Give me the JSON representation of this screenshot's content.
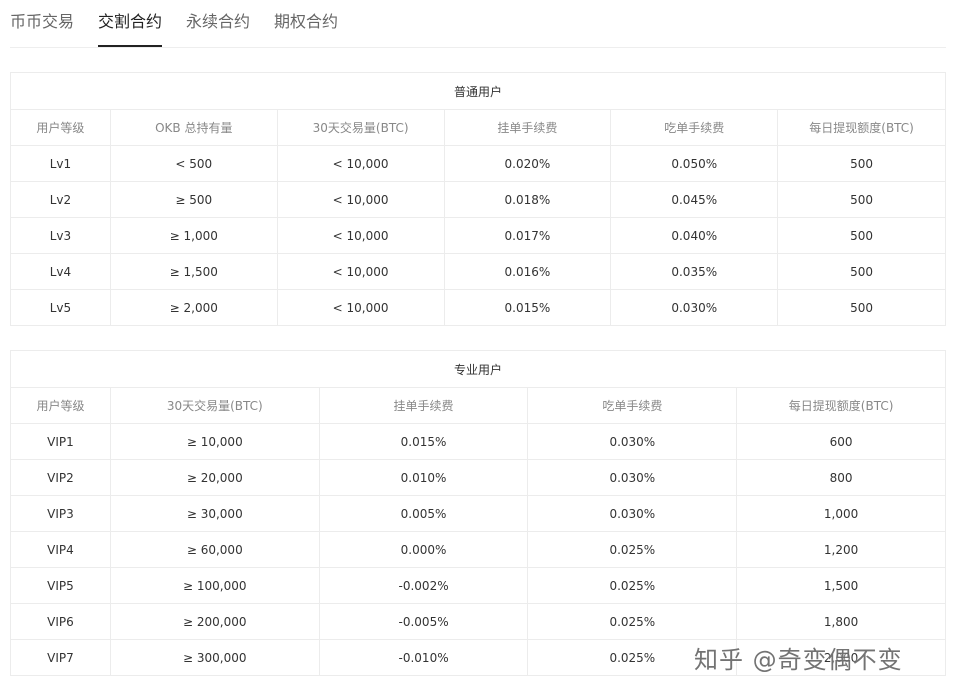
{
  "tabs": [
    {
      "label": "币币交易",
      "active": false
    },
    {
      "label": "交割合约",
      "active": true
    },
    {
      "label": "永续合约",
      "active": false
    },
    {
      "label": "期权合约",
      "active": false
    }
  ],
  "regular": {
    "title": "普通用户",
    "headers": [
      "用户等级",
      "OKB 总持有量",
      "30天交易量(BTC)",
      "挂单手续费",
      "吃单手续费",
      "每日提现额度(BTC)"
    ],
    "rows": [
      [
        "Lv1",
        "< 500",
        "< 10,000",
        "0.020%",
        "0.050%",
        "500"
      ],
      [
        "Lv2",
        "≥ 500",
        "< 10,000",
        "0.018%",
        "0.045%",
        "500"
      ],
      [
        "Lv3",
        "≥ 1,000",
        "< 10,000",
        "0.017%",
        "0.040%",
        "500"
      ],
      [
        "Lv4",
        "≥ 1,500",
        "< 10,000",
        "0.016%",
        "0.035%",
        "500"
      ],
      [
        "Lv5",
        "≥ 2,000",
        "< 10,000",
        "0.015%",
        "0.030%",
        "500"
      ]
    ]
  },
  "pro": {
    "title": "专业用户",
    "headers": [
      "用户等级",
      "30天交易量(BTC)",
      "挂单手续费",
      "吃单手续费",
      "每日提现额度(BTC)"
    ],
    "rows": [
      [
        "VIP1",
        "≥ 10,000",
        "0.015%",
        "0.030%",
        "600"
      ],
      [
        "VIP2",
        "≥ 20,000",
        "0.010%",
        "0.030%",
        "800"
      ],
      [
        "VIP3",
        "≥ 30,000",
        "0.005%",
        "0.030%",
        "1,000"
      ],
      [
        "VIP4",
        "≥ 60,000",
        "0.000%",
        "0.025%",
        "1,200"
      ],
      [
        "VIP5",
        "≥ 100,000",
        "-0.002%",
        "0.025%",
        "1,500"
      ],
      [
        "VIP6",
        "≥ 200,000",
        "-0.005%",
        "0.025%",
        "1,800"
      ],
      [
        "VIP7",
        "≥ 300,000",
        "-0.010%",
        "0.025%",
        "2,000"
      ]
    ]
  },
  "watermark": "知乎 @奇变偶不变"
}
